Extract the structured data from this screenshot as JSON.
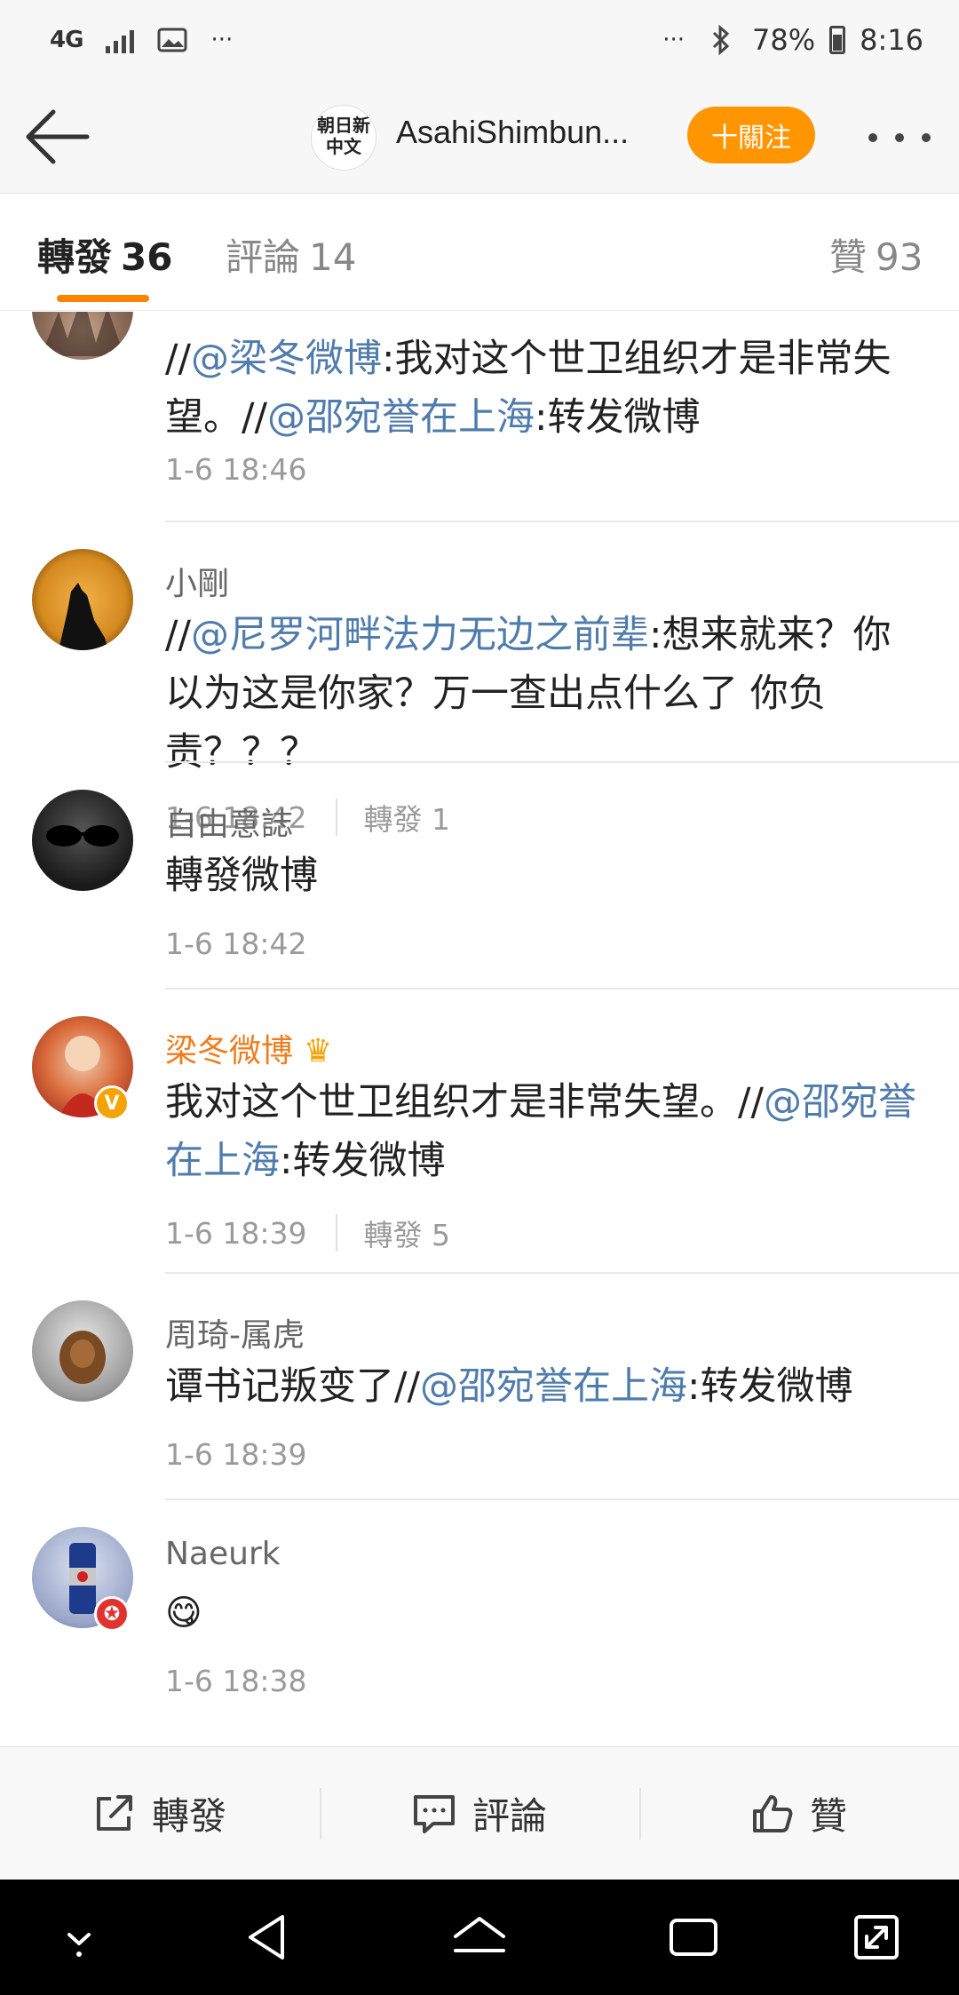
{
  "status_bar": {
    "network": "4G",
    "battery": "78%",
    "time": "8:16",
    "left_more": "···",
    "right_more": "···"
  },
  "nav": {
    "logo_text_line1": "朝日新",
    "logo_text_line2": "中文",
    "page_name": "AsahiShimbun...",
    "follow_label": "十關注"
  },
  "tabs": [
    {
      "label": "轉發",
      "count": "36",
      "active": true
    },
    {
      "label": "評論",
      "count": "14",
      "active": false
    },
    {
      "label": "贊",
      "count": "93",
      "active": false
    }
  ],
  "items": [
    {
      "segments": [
        {
          "text": "//",
          "mention": false
        },
        {
          "text": "@梁冬微博",
          "mention": true
        },
        {
          "text": ":我对这个世卫组织才是非常失望。//",
          "mention": false
        },
        {
          "text": "@邵宛誉在上海",
          "mention": true
        },
        {
          "text": ":转发微博",
          "mention": false
        }
      ],
      "time": "1-6 18:46"
    },
    {
      "username": "小剛",
      "segments": [
        {
          "text": "//",
          "mention": false
        },
        {
          "text": "@尼罗河畔法力无边之前辈",
          "mention": true
        },
        {
          "text": ":想来就来？你以为这是你家？万一查出点什么了 你负责？？？",
          "mention": false
        }
      ],
      "time": "1-6 18:42",
      "reposts": "轉發 1"
    },
    {
      "username": "自由意誌",
      "segments": [
        {
          "text": "轉發微博",
          "mention": false
        }
      ],
      "time": "1-6 18:42"
    },
    {
      "username": "梁冬微博",
      "segments": [
        {
          "text": "我对这个世卫组织才是非常失望。//",
          "mention": false
        },
        {
          "text": "@邵宛誉在上海",
          "mention": true
        },
        {
          "text": ":转发微博",
          "mention": false
        }
      ],
      "time": "1-6 18:39",
      "reposts": "轉發 5"
    },
    {
      "username": "周琦-属虎",
      "segments": [
        {
          "text": "谭书记叛变了//",
          "mention": false
        },
        {
          "text": "@邵宛誉在上海",
          "mention": true
        },
        {
          "text": ":转发微博",
          "mention": false
        }
      ],
      "time": "1-6 18:39"
    },
    {
      "username": "Naeurk",
      "emoji": "😋",
      "time": "1-6 18:38"
    }
  ],
  "actions": [
    {
      "label": "轉發",
      "icon": "share-icon"
    },
    {
      "label": "評論",
      "icon": "comment-icon"
    },
    {
      "label": "贊",
      "icon": "thumbs-up-icon"
    }
  ],
  "colors": {
    "accent": "#ff8200",
    "follow": "#ff9500",
    "mention": "#4f7cac",
    "vip_name": "#f07c1c"
  }
}
